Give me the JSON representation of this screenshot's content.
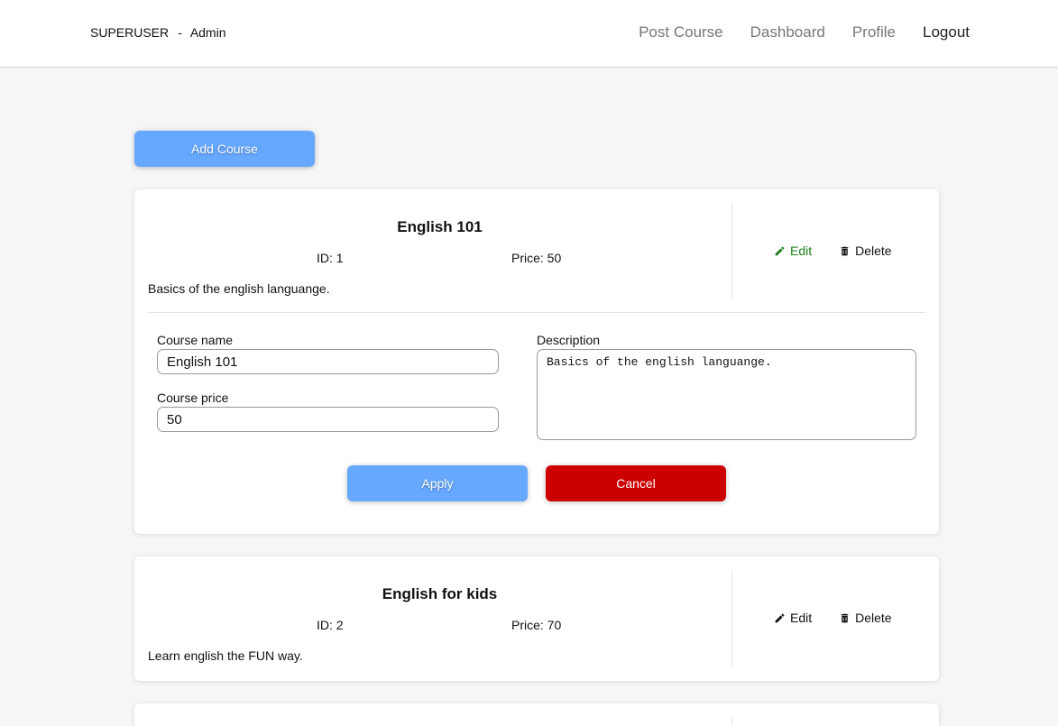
{
  "nav": {
    "brand_user": "SUPERUSER",
    "brand_sep": "-",
    "brand_role": "Admin",
    "links": [
      "Post Course",
      "Dashboard",
      "Profile",
      "Logout"
    ]
  },
  "add_course_label": "Add Course",
  "courses": [
    {
      "title": "English 101",
      "id_text": "ID: 1",
      "price_text": "Price: 50",
      "description": "Basics of the english languange.",
      "edit_label": "Edit",
      "delete_label": "Delete"
    },
    {
      "title": "English for kids",
      "id_text": "ID: 2",
      "price_text": "Price: 70",
      "description": "Learn english the FUN way.",
      "edit_label": "Edit",
      "delete_label": "Delete"
    }
  ],
  "edit_form": {
    "name_label": "Course name",
    "name_value": "English 101",
    "price_label": "Course price",
    "price_value": "50",
    "description_label": "Description",
    "description_value": "Basics of the english languange.",
    "apply_label": "Apply",
    "cancel_label": "Cancel"
  },
  "colors": {
    "primary": "#66a8ff",
    "danger": "#cc0000",
    "edit_active": "#1a7f1a"
  },
  "icons": {
    "edit": "pencil-icon",
    "delete": "trash-icon"
  }
}
